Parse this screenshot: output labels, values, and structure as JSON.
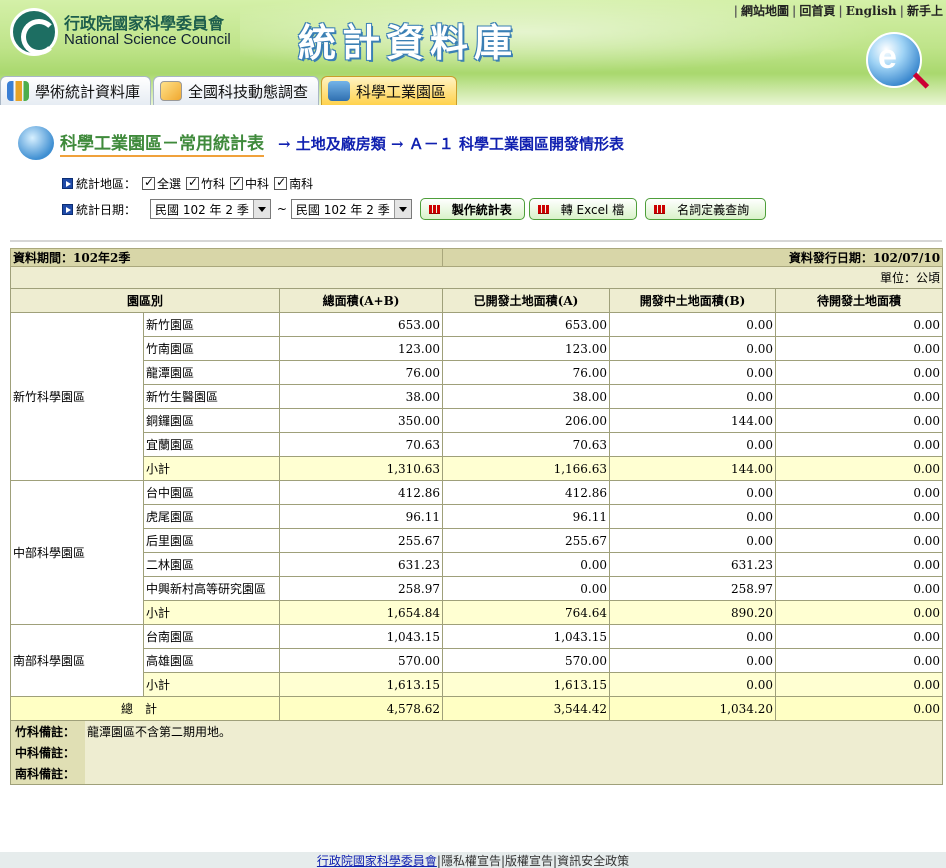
{
  "header": {
    "org_zh": "行政院國家科學委員會",
    "org_en": "National Science Council",
    "db_title": "統計資料庫",
    "top_links": [
      "網站地圖",
      "回首頁",
      "English",
      "新手上"
    ],
    "tabs": [
      "學術統計資料庫",
      "全國科技動態調查",
      "科學工業園區"
    ]
  },
  "page": {
    "title": "科學工業園區－常用統計表",
    "path": "→ 土地及廠房類 → Ａ－１ 科學工業園區開發情形表"
  },
  "filters": {
    "region_label": "統計地區：",
    "regions": [
      "全選",
      "竹科",
      "中科",
      "南科"
    ],
    "date_label": "統計日期：",
    "date_from": "民國 102 年 2 季",
    "date_to": "民國 102 年 2 季",
    "tilde": "~",
    "buttons": [
      "製作統計表",
      "轉 Excel 檔",
      "名詞定義查詢"
    ]
  },
  "table": {
    "period": "資料期間：102年2季",
    "release": "資料發行日期：102/07/10",
    "unit": "單位：公頃",
    "headers": [
      "園區別",
      "總面積(A+B)",
      "已開發土地面積(A)",
      "開發中土地面積(B)",
      "待開發土地面積"
    ],
    "groups": [
      {
        "name": "新竹科學園區",
        "rows": [
          [
            "新竹園區",
            "653.00",
            "653.00",
            "0.00",
            "0.00"
          ],
          [
            "竹南園區",
            "123.00",
            "123.00",
            "0.00",
            "0.00"
          ],
          [
            "龍潭園區",
            "76.00",
            "76.00",
            "0.00",
            "0.00"
          ],
          [
            "新竹生醫園區",
            "38.00",
            "38.00",
            "0.00",
            "0.00"
          ],
          [
            "銅鑼園區",
            "350.00",
            "206.00",
            "144.00",
            "0.00"
          ],
          [
            "宜蘭園區",
            "70.63",
            "70.63",
            "0.00",
            "0.00"
          ],
          [
            "小計",
            "1,310.63",
            "1,166.63",
            "144.00",
            "0.00"
          ]
        ]
      },
      {
        "name": "中部科學園區",
        "rows": [
          [
            "台中園區",
            "412.86",
            "412.86",
            "0.00",
            "0.00"
          ],
          [
            "虎尾園區",
            "96.11",
            "96.11",
            "0.00",
            "0.00"
          ],
          [
            "后里園區",
            "255.67",
            "255.67",
            "0.00",
            "0.00"
          ],
          [
            "二林園區",
            "631.23",
            "0.00",
            "631.23",
            "0.00"
          ],
          [
            "中興新村高等研究園區",
            "258.97",
            "0.00",
            "258.97",
            "0.00"
          ],
          [
            "小計",
            "1,654.84",
            "764.64",
            "890.20",
            "0.00"
          ]
        ]
      },
      {
        "name": "南部科學園區",
        "rows": [
          [
            "台南園區",
            "1,043.15",
            "1,043.15",
            "0.00",
            "0.00"
          ],
          [
            "高雄園區",
            "570.00",
            "570.00",
            "0.00",
            "0.00"
          ],
          [
            "小計",
            "1,613.15",
            "1,613.15",
            "0.00",
            "0.00"
          ]
        ]
      }
    ],
    "total": [
      "總計",
      "4,578.62",
      "3,544.42",
      "1,034.20",
      "0.00"
    ],
    "notes": [
      {
        "label": "竹科備註：",
        "text": "龍潭園區不含第二期用地。"
      },
      {
        "label": "中科備註：",
        "text": ""
      },
      {
        "label": "南科備註：",
        "text": ""
      }
    ]
  },
  "footer": {
    "links": [
      "行政院國家科學委員會",
      "隱私權宣告",
      "版權宣告",
      "資訊安全政策"
    ]
  }
}
